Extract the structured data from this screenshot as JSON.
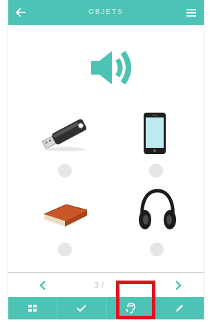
{
  "header": {
    "title": "OBJETS",
    "back_icon": "arrow-left-icon",
    "menu_icon": "hamburger-menu-icon"
  },
  "audio": {
    "icon": "speaker-volume-icon"
  },
  "items": [
    {
      "icon": "usb-key-icon",
      "selected": false
    },
    {
      "icon": "smartphone-icon",
      "selected": false
    },
    {
      "icon": "book-icon",
      "selected": false
    },
    {
      "icon": "headphones-icon",
      "selected": false
    }
  ],
  "pager": {
    "prev_icon": "chevron-left-icon",
    "next_icon": "chevron-right-icon",
    "count": "3 /"
  },
  "bottom_bar": [
    {
      "icon": "grid-icon"
    },
    {
      "icon": "checkmark-icon"
    },
    {
      "icon": "ear-listen-icon"
    },
    {
      "icon": "pencil-icon"
    }
  ],
  "colors": {
    "primary": "#4cc3b4",
    "highlight": "#e0141e",
    "radio": "#e6e6e6"
  }
}
